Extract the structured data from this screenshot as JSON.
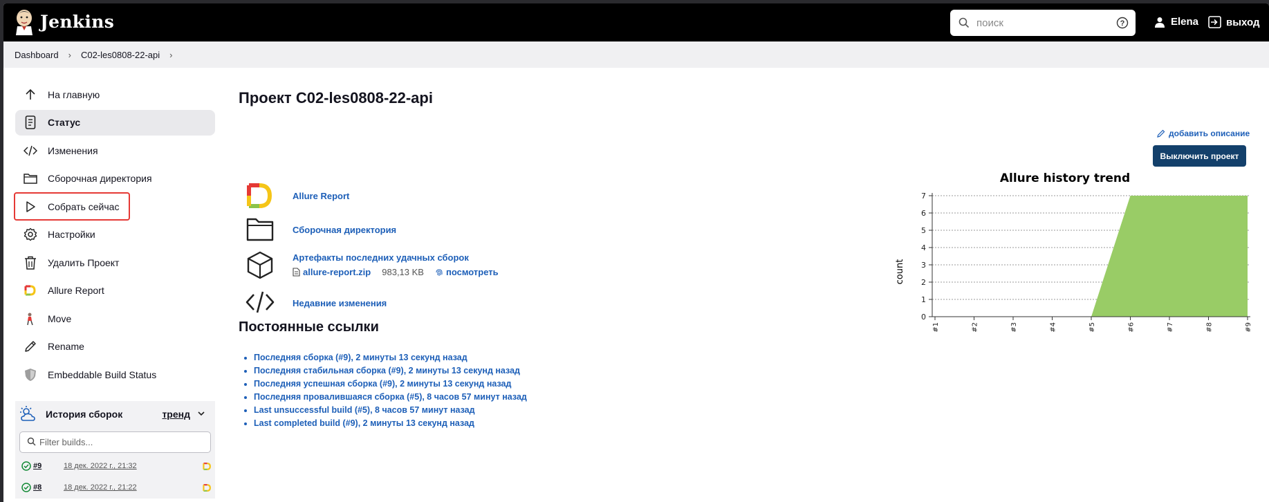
{
  "header": {
    "app_name": "Jenkins",
    "search_placeholder": "поиск",
    "user_name": "Elena",
    "logout_label": "выход"
  },
  "breadcrumb": [
    "Dashboard",
    "C02-les0808-22-api"
  ],
  "sidebar": {
    "items": [
      {
        "label": "На главную",
        "icon": "arrow-up-icon"
      },
      {
        "label": "Статус",
        "icon": "status-document-icon",
        "active": true
      },
      {
        "label": "Изменения",
        "icon": "code-icon"
      },
      {
        "label": "Сборочная директория",
        "icon": "folder-icon"
      },
      {
        "label": "Собрать сейчас",
        "icon": "play-icon",
        "highlighted": true
      },
      {
        "label": "Настройки",
        "icon": "gear-icon"
      },
      {
        "label": "Удалить Проект",
        "icon": "trash-icon"
      },
      {
        "label": "Allure Report",
        "icon": "allure-icon"
      },
      {
        "label": "Move",
        "icon": "move-icon"
      },
      {
        "label": "Rename",
        "icon": "pencil-icon"
      },
      {
        "label": "Embeddable Build Status",
        "icon": "badge-shield-icon"
      }
    ]
  },
  "build_history": {
    "title": "История сборок",
    "trend_label": "тренд",
    "filter_placeholder": "Filter builds...",
    "builds": [
      {
        "number": "#9",
        "date": "18 дек. 2022 г., 21:32",
        "status": "success"
      },
      {
        "number": "#8",
        "date": "18 дек. 2022 г., 21:22",
        "status": "success"
      }
    ]
  },
  "main": {
    "title": "Проект C02-les0808-22-api",
    "add_description": "добавить описание",
    "disable_button": "Выключить проект",
    "links": {
      "allure": "Allure Report",
      "workspace": "Сборочная директория",
      "artifacts": "Артефакты последних удачных сборок",
      "artifact_file": "allure-report.zip",
      "artifact_size": "983,13 KB",
      "artifact_view": "посмотреть",
      "changes": "Недавние изменения"
    },
    "permalinks_title": "Постоянные ссылки",
    "permalinks": [
      "Последняя сборка (#9), 2 минуты 13 секунд назад",
      "Последняя стабильная сборка (#9), 2 минуты 13 секунд назад",
      "Последняя успешная сборка (#9), 2 минуты 13 секунд назад",
      "Последняя провалившаяся сборка (#5), 8 часов 57 минут назад",
      "Last unsuccessful build (#5), 8 часов 57 минут назад",
      "Last completed build (#9), 2 минуты 13 секунд назад"
    ]
  },
  "chart_data": {
    "type": "area",
    "title": "Allure history trend",
    "xlabel": "",
    "ylabel": "count",
    "categories": [
      "#1",
      "#2",
      "#3",
      "#4",
      "#5",
      "#6",
      "#7",
      "#8",
      "#9"
    ],
    "series": [
      {
        "values": [
          null,
          null,
          null,
          null,
          0,
          7,
          7,
          7,
          7
        ],
        "color": "#99cc66"
      }
    ],
    "ylim": [
      0,
      7
    ],
    "yticks": [
      0,
      1,
      2,
      3,
      4,
      5,
      6,
      7
    ],
    "grid": true
  }
}
